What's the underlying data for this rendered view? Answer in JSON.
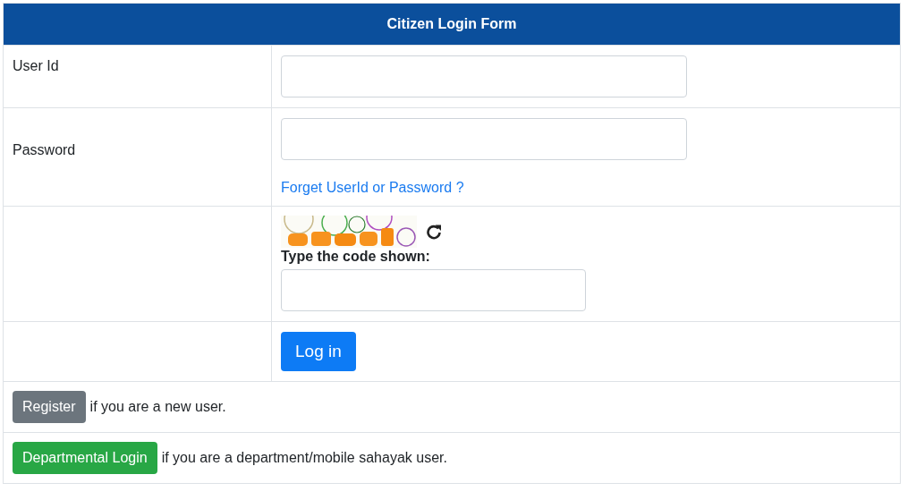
{
  "form": {
    "title": "Citizen Login Form",
    "fields": [
      {
        "kind": "text",
        "label": "User Id"
      },
      {
        "kind": "password",
        "label": "Password",
        "link": "Forget UserId or Password ?"
      },
      {
        "kind": "captcha",
        "prompt": "Type the code shown:"
      }
    ],
    "submit": "Log in",
    "footer": [
      {
        "kind": "secondary",
        "button": "Register",
        "text": "if you are a new user."
      },
      {
        "kind": "success",
        "button": "Departmental Login",
        "text": "if you are a department/mobile sahayak user."
      }
    ]
  }
}
